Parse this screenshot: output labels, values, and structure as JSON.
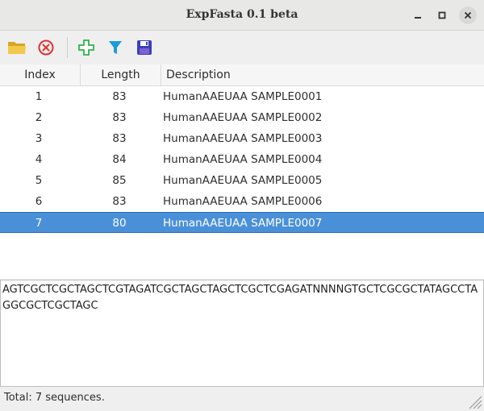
{
  "window": {
    "title": "ExpFasta 0.1 beta"
  },
  "toolbar": {
    "buttons": [
      {
        "icon": "folder-open-icon",
        "color": "#e8b836"
      },
      {
        "icon": "cancel-circle-icon",
        "color": "#e03131"
      },
      {
        "icon": "plus-icon",
        "color": "#2fb34a"
      },
      {
        "icon": "filter-icon",
        "color": "#1b9cd8"
      },
      {
        "icon": "save-floppy-icon",
        "color": "#3b3fb5"
      }
    ]
  },
  "table": {
    "headers": {
      "index": "Index",
      "length": "Length",
      "description": "Description"
    },
    "rows": [
      {
        "index": "1",
        "length": "83",
        "description": "HumanAAEUAA SAMPLE0001"
      },
      {
        "index": "2",
        "length": "83",
        "description": "HumanAAEUAA SAMPLE0002"
      },
      {
        "index": "3",
        "length": "83",
        "description": "HumanAAEUAA SAMPLE0003"
      },
      {
        "index": "4",
        "length": "84",
        "description": "HumanAAEUAA SAMPLE0004"
      },
      {
        "index": "5",
        "length": "85",
        "description": "HumanAAEUAA SAMPLE0005"
      },
      {
        "index": "6",
        "length": "83",
        "description": "HumanAAEUAA SAMPLE0006"
      },
      {
        "index": "7",
        "length": "80",
        "description": "HumanAAEUAA SAMPLE0007"
      }
    ],
    "selected_row": 7,
    "selection_color": "#4a90d9"
  },
  "sequence": {
    "text": "AGTCGCTCGCTAGCTCGTAGATCGCTAGCTAGCTCGCTCGAGATNNNNGTGCTCGCGCTATAGCCTAGGCGCTCGCTAGC"
  },
  "status": {
    "text": "Total: 7 sequences."
  }
}
